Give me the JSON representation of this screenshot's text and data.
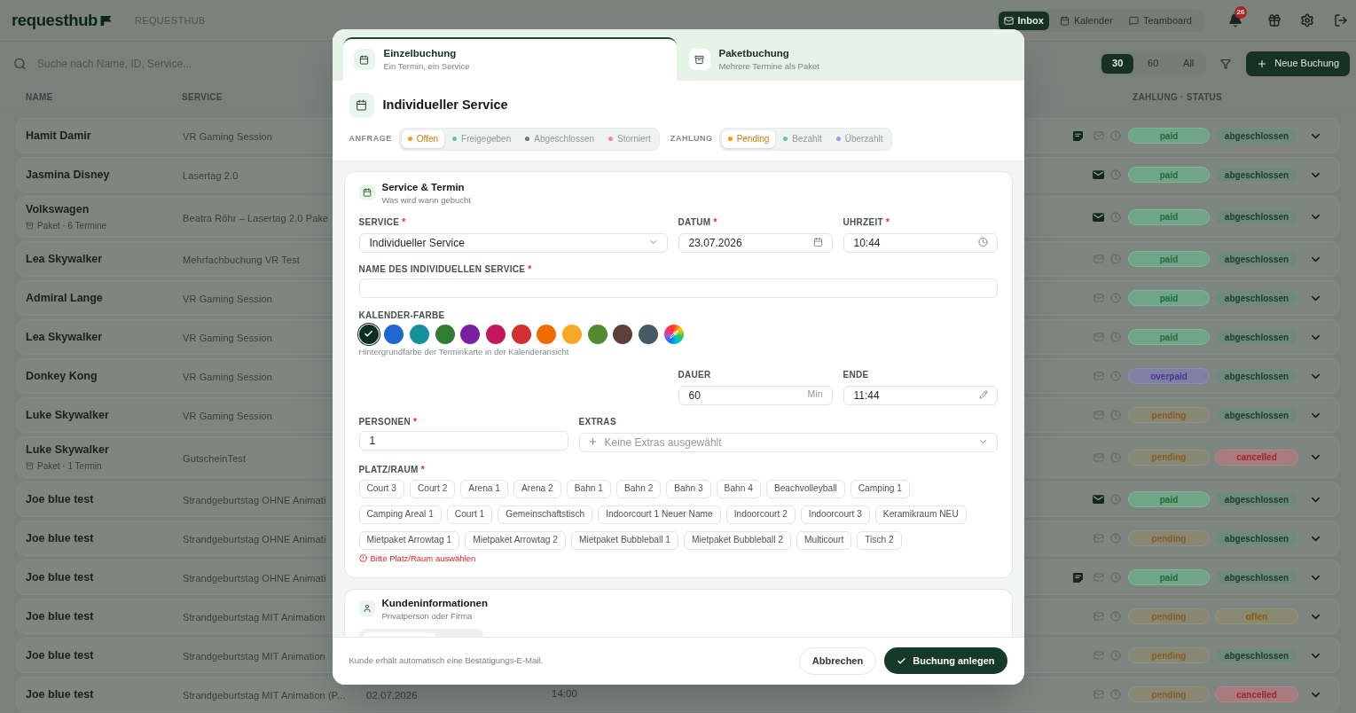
{
  "header": {
    "logo": "requesthub",
    "app_name": "REQUESTHUB",
    "nav": [
      {
        "label": "Inbox",
        "selected": true
      },
      {
        "label": "Kalender",
        "selected": false
      },
      {
        "label": "Teamboard",
        "selected": false
      }
    ],
    "notification_count": "26"
  },
  "toolbar": {
    "search": {
      "placeholder": "Suche nach Name, ID, Service..."
    },
    "ranges": [
      {
        "label": "30",
        "selected": true
      },
      {
        "label": "60",
        "selected": false
      },
      {
        "label": "All",
        "selected": false
      }
    ],
    "new_booking": "Neue Buchung"
  },
  "table": {
    "columns": [
      "NAME",
      "SERVICE",
      "ZAHLUNG · STATUS"
    ],
    "rows": [
      {
        "name": "Hamit Damir",
        "service": "VR Gaming Session",
        "note": true,
        "mail_sent": false,
        "payment": {
          "text": "paid",
          "kind": "paid"
        },
        "status": {
          "text": "abgeschlossen",
          "kind": "done"
        }
      },
      {
        "name": "Jasmina Disney",
        "service": "Lasertag 2.0",
        "note": false,
        "mail_sent": true,
        "payment": {
          "text": "paid",
          "kind": "paid"
        },
        "status": {
          "text": "abgeschlossen",
          "kind": "done"
        }
      },
      {
        "name": "Volkswagen",
        "subtitle": "Paket · 6 Termine",
        "service": "Beatra Röhr – Lasertag 2.0 Pake",
        "note": false,
        "mail_sent": true,
        "payment": {
          "text": "paid",
          "kind": "paid"
        },
        "status": {
          "text": "abgeschlossen",
          "kind": "done"
        }
      },
      {
        "name": "Lea Skywalker",
        "service": "Mehrfachbuchung VR Test",
        "note": false,
        "mail_sent": false,
        "payment": {
          "text": "paid",
          "kind": "paid"
        },
        "status": {
          "text": "abgeschlossen",
          "kind": "done"
        }
      },
      {
        "name": "Admiral Lange",
        "service": "VR Gaming Session",
        "note": false,
        "mail_sent": false,
        "payment": {
          "text": "paid",
          "kind": "paid"
        },
        "status": {
          "text": "abgeschlossen",
          "kind": "done"
        }
      },
      {
        "name": "Lea Skywalker",
        "service": "VR Gaming Session",
        "note": false,
        "mail_sent": false,
        "payment": {
          "text": "paid",
          "kind": "paid"
        },
        "status": {
          "text": "abgeschlossen",
          "kind": "done"
        }
      },
      {
        "name": "Donkey Kong",
        "service": "VR Gaming Session",
        "note": false,
        "mail_sent": false,
        "payment": {
          "text": "overpaid",
          "kind": "overpaid"
        },
        "status": {
          "text": "abgeschlossen",
          "kind": "done"
        }
      },
      {
        "name": "Luke Skywalker",
        "service": "VR Gaming Session",
        "note": false,
        "mail_sent": false,
        "payment": {
          "text": "pending",
          "kind": "pending"
        },
        "status": {
          "text": "abgeschlossen",
          "kind": "done"
        }
      },
      {
        "name": "Luke Skywalker",
        "subtitle": "Paket · 1 Termin",
        "service": "GutscheinTest",
        "note": false,
        "mail_sent": false,
        "payment": {
          "text": "pending",
          "kind": "pending"
        },
        "status": {
          "text": "cancelled",
          "kind": "cancelled"
        }
      },
      {
        "name": "Joe blue test",
        "service": "Strandgeburtstag OHNE Animati",
        "note": false,
        "mail_sent": true,
        "payment": {
          "text": "paid",
          "kind": "paid"
        },
        "status": {
          "text": "abgeschlossen",
          "kind": "done"
        }
      },
      {
        "name": "Joe blue test",
        "service": "Strandgeburtstag OHNE Animati",
        "note": false,
        "mail_sent": false,
        "payment": {
          "text": "pending",
          "kind": "pending"
        },
        "status": {
          "text": "abgeschlossen",
          "kind": "done"
        }
      },
      {
        "name": "Joe blue test",
        "service": "Strandgeburtstag OHNE Animati",
        "note": true,
        "mail_sent": false,
        "payment": {
          "text": "paid",
          "kind": "paid"
        },
        "status": {
          "text": "abgeschlossen",
          "kind": "done"
        }
      },
      {
        "name": "Joe blue test",
        "service": "Strandgeburtstag MIT Animation",
        "note": false,
        "mail_sent": false,
        "payment": {
          "text": "pending",
          "kind": "pending"
        },
        "status": {
          "text": "offen",
          "kind": "open"
        }
      },
      {
        "name": "Joe blue test",
        "service": "Strandgeburtstag MIT Animation",
        "note": false,
        "mail_sent": false,
        "payment": {
          "text": "pending",
          "kind": "pending"
        },
        "status": {
          "text": "abgeschlossen",
          "kind": "done"
        }
      },
      {
        "name": "Joe blue test",
        "service": "Strandgeburtstag MIT Animation (P...",
        "date": "02.07.2026",
        "time": "14:00",
        "note": false,
        "mail_sent": false,
        "payment": {
          "text": "pending",
          "kind": "pending"
        },
        "status": {
          "text": "cancelled",
          "kind": "cancelled"
        }
      }
    ]
  },
  "dialog": {
    "tabs": [
      {
        "title": "Einzelbuchung",
        "subtitle": "Ein Termin, ein Service",
        "selected": true
      },
      {
        "title": "Paketbuchung",
        "subtitle": "Mehrere Termine als Paket",
        "selected": false
      }
    ],
    "title": "Individueller Service",
    "request_label": "ANFRAGE",
    "request_states": [
      {
        "label": "Offen",
        "color": "#f59e0b",
        "selected": true
      },
      {
        "label": "Freigegeben",
        "color": "#6cc59a",
        "selected": false
      },
      {
        "label": "Abgeschlossen",
        "color": "#6b7a72",
        "selected": false
      },
      {
        "label": "Storniert",
        "color": "#f0908c",
        "selected": false
      }
    ],
    "payment_label": "ZAHLUNG",
    "payment_states": [
      {
        "label": "Pending",
        "color": "#f59e0b",
        "selected": true
      },
      {
        "label": "Bezahlt",
        "color": "#6cc59a",
        "selected": false
      },
      {
        "label": "Überzahlt",
        "color": "#8fa2f2",
        "selected": false
      }
    ],
    "service_section": {
      "title": "Service & Termin",
      "subtitle": "Was wird wann gebucht",
      "service": {
        "label": "SERVICE",
        "required_mark": "*",
        "value": "Individueller Service"
      },
      "date": {
        "label": "DATUM",
        "required_mark": "*",
        "value": "23.07.2026"
      },
      "time": {
        "label": "UHRZEIT",
        "required_mark": "*",
        "value": "10:44"
      },
      "custom_name": {
        "label": "NAME DES INDIVIDUELLEN SERVICE",
        "required_mark": "*"
      },
      "calendar_color": {
        "label": "KALENDER-FARBE",
        "swatches": [
          {
            "kind": "solid",
            "color": "#0f2e22",
            "selected": true
          },
          {
            "kind": "solid",
            "color": "#1e66d0",
            "selected": false
          },
          {
            "kind": "solid",
            "color": "#16909a",
            "selected": false
          },
          {
            "kind": "solid",
            "color": "#2e7d32",
            "selected": false
          },
          {
            "kind": "solid",
            "color": "#7b1fa2",
            "selected": false
          },
          {
            "kind": "solid",
            "color": "#c2185b",
            "selected": false
          },
          {
            "kind": "solid",
            "color": "#d32f2f",
            "selected": false
          },
          {
            "kind": "solid",
            "color": "#ef6c00",
            "selected": false
          },
          {
            "kind": "solid",
            "color": "#f9a825",
            "selected": false
          },
          {
            "kind": "solid",
            "color": "#558b2f",
            "selected": false
          },
          {
            "kind": "solid",
            "color": "#5d4037",
            "selected": false
          },
          {
            "kind": "solid",
            "color": "#455a64",
            "selected": false
          },
          {
            "kind": "custom",
            "selected": false
          }
        ],
        "hint": "Hintergrundfarbe der Terminkarte in der Kalenderansicht"
      },
      "duration": {
        "label": "DAUER",
        "value": "60",
        "unit": "Min"
      },
      "end": {
        "label": "ENDE",
        "value": "11:44"
      },
      "persons": {
        "label": "PERSONEN",
        "required_mark": "*",
        "value": "1"
      },
      "extras": {
        "label": "EXTRAS",
        "placeholder": "Keine Extras ausgewählt"
      },
      "rooms": {
        "label": "PLATZ/RAUM",
        "required_mark": "*",
        "options": [
          {
            "label": "Court 3",
            "selected": false
          },
          {
            "label": "Court 2",
            "selected": false
          },
          {
            "label": "Arena 1",
            "selected": false
          },
          {
            "label": "Arena 2",
            "selected": false
          },
          {
            "label": "Bahn 1",
            "selected": false
          },
          {
            "label": "Bahn 2",
            "selected": false
          },
          {
            "label": "Bahn 3",
            "selected": false
          },
          {
            "label": "Bahn 4",
            "selected": false
          },
          {
            "label": "Beachvolleyball",
            "selected": false
          },
          {
            "label": "Camping 1",
            "selected": false
          },
          {
            "label": "Camping Areal 1",
            "selected": false
          },
          {
            "label": "Court 1",
            "selected": false
          },
          {
            "label": "Gemeinschaftstisch",
            "selected": false
          },
          {
            "label": "Indoorcourt 1 Neuer Name",
            "selected": false
          },
          {
            "label": "Indoorcourt 2",
            "selected": false
          },
          {
            "label": "Indoorcourt 3",
            "selected": false
          },
          {
            "label": "Keramikraum NEU",
            "selected": false
          },
          {
            "label": "Mietpaket Arrowtag 1",
            "selected": false
          },
          {
            "label": "Mietpaket Arrowtag 2",
            "selected": false
          },
          {
            "label": "Mietpaket Bubbleball 1",
            "selected": false
          },
          {
            "label": "Mietpaket Bubbleball 2",
            "selected": false
          },
          {
            "label": "Multicourt",
            "selected": false
          },
          {
            "label": "Tisch 2",
            "selected": false
          }
        ],
        "error": "Bitte Platz/Raum auswählen"
      }
    },
    "customer_section": {
      "title": "Kundeninformationen",
      "subtitle": "Privatperson oder Firma"
    },
    "footer": {
      "note": "Kunde erhält automatisch eine Bestätigungs-E-Mail.",
      "cancel": "Abbrechen",
      "submit": "Buchung anlegen"
    }
  }
}
